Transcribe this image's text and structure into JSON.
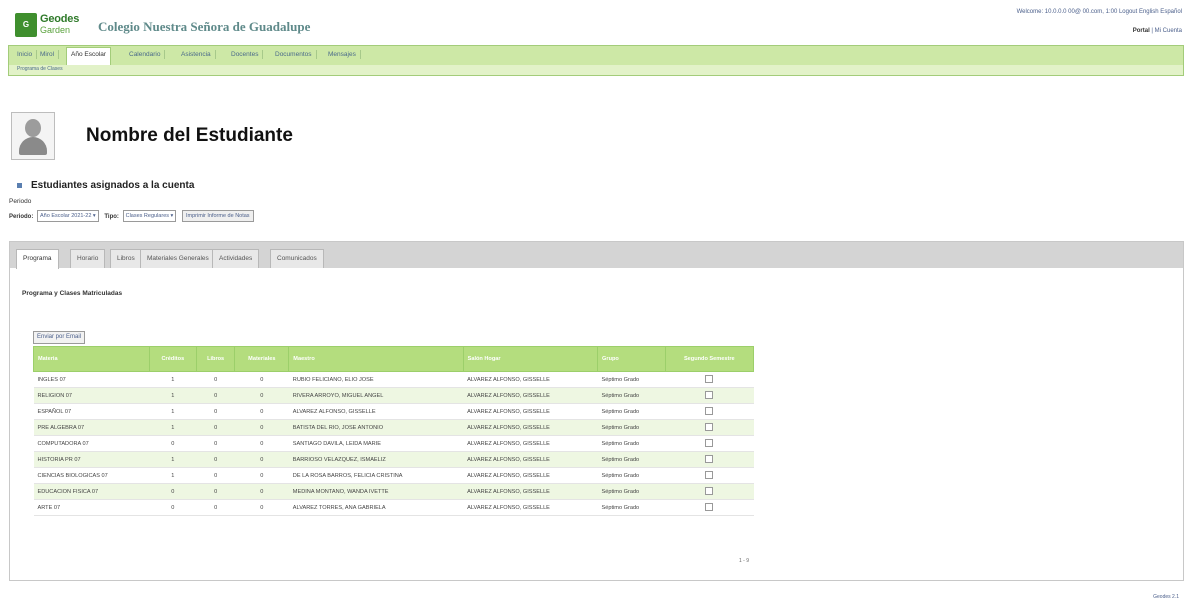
{
  "header": {
    "logo_line1": "Geodes",
    "logo_line2": "Garden",
    "school_name": "Colegio Nuestra Señora de Guadalupe",
    "account_info": "Welcome: 10.0.0.0 00@ 00.com, 1:00  Logout  English  Español",
    "portal_label": "Portal",
    "portal_extra": "| Mi Cuenta"
  },
  "nav": {
    "tabs": [
      "Inicio",
      "Mirol",
      "Año Escolar",
      "Calendario",
      "Asistencia",
      "Docentes",
      "Documentos",
      "Mensajes"
    ],
    "active_index": 2,
    "subnav": "Programa de Clases"
  },
  "student": {
    "name": "Nombre del Estudiante",
    "assigned_heading": "Estudiantes asignados a la cuenta"
  },
  "filters": {
    "periodo_label": "Periodo",
    "periodo_field_label": "Periodo:",
    "periodo_value": "Año Escolar 2021-22",
    "tipo_label": "Tipo:",
    "tipo_value": "Clases Regulares",
    "print_button": "Imprimir Informe de Notas"
  },
  "panel": {
    "tabs": [
      "Programa",
      "Horario",
      "Libros",
      "Materiales Generales",
      "Actividades",
      "Comunicados"
    ],
    "active_index": 0,
    "title": "Programa y Clases Matriculadas",
    "email_button": "Enviar por Email"
  },
  "table": {
    "columns": [
      "Materia",
      "Créditos",
      "Libros",
      "Materiales",
      "Maestro",
      "Salón Hogar",
      "Grupo",
      "Segundo Semestre"
    ],
    "rows": [
      [
        "INGLES 07",
        "1",
        "0",
        "0",
        "RUBIO FELICIANO, ELIO JOSE",
        "ALVAREZ ALFONSO, GISSELLE",
        "Séptimo Grado"
      ],
      [
        "RELIGION 07",
        "1",
        "0",
        "0",
        "RIVERA ARROYO, MIGUEL ANGEL",
        "ALVAREZ ALFONSO, GISSELLE",
        "Séptimo Grado"
      ],
      [
        "ESPAÑOL 07",
        "1",
        "0",
        "0",
        "ALVAREZ ALFONSO, GISSELLE",
        "ALVAREZ ALFONSO, GISSELLE",
        "Séptimo Grado"
      ],
      [
        "PRE ALGEBRA 07",
        "1",
        "0",
        "0",
        "BATISTA DEL RIO, JOSE ANTONIO",
        "ALVAREZ ALFONSO, GISSELLE",
        "Séptimo Grado"
      ],
      [
        "COMPUTADORA 07",
        "0",
        "0",
        "0",
        "SANTIAGO DAVILA, LEIDA MARIE",
        "ALVAREZ ALFONSO, GISSELLE",
        "Séptimo Grado"
      ],
      [
        "HISTORIA PR 07",
        "1",
        "0",
        "0",
        "BARRIOSO VELAZQUEZ, ISMAELIZ",
        "ALVAREZ ALFONSO, GISSELLE",
        "Séptimo Grado"
      ],
      [
        "CIENCIAS BIOLOGICAS 07",
        "1",
        "0",
        "0",
        "DE LA ROSA BARROS, FELICIA CRISTINA",
        "ALVAREZ ALFONSO, GISSELLE",
        "Séptimo Grado"
      ],
      [
        "EDUCACION FISICA 07",
        "0",
        "0",
        "0",
        "MEDINA MONTANO, WANDA IVETTE",
        "ALVAREZ ALFONSO, GISSELLE",
        "Séptimo Grado"
      ],
      [
        "ARTE 07",
        "0",
        "0",
        "0",
        "ALVAREZ TORRES, ANA GABRIELA",
        "ALVAREZ ALFONSO, GISSELLE",
        "Séptimo Grado"
      ]
    ],
    "pager": "1 - 9"
  },
  "footer": {
    "text": "Geodes 2.1"
  },
  "colors": {
    "nav_green": "#cde8a6",
    "header_green": "#b4dd7e",
    "alt_row": "#eef7e2"
  }
}
